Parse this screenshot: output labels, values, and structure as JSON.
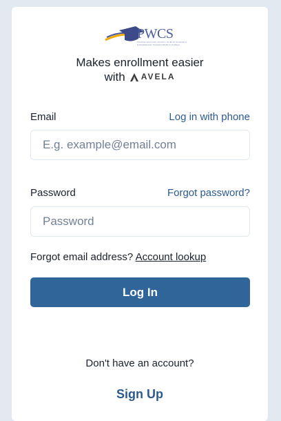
{
  "brand": {
    "logo_text": "PWCS",
    "logo_subline1": "PRINCE WILLIAM COUNTY PUBLIC SCHOOLS",
    "logo_subline2": "EXPERIENCE TRANSFORMS FUTURES",
    "tagline_line1": "Makes enrollment easier",
    "tagline_with": "with",
    "partner_name": "AVELA"
  },
  "form": {
    "email_label": "Email",
    "phone_link": "Log in with phone",
    "email_placeholder": "E.g. example@email.com",
    "email_value": "",
    "password_label": "Password",
    "forgot_password_link": "Forgot password?",
    "password_placeholder": "Password",
    "password_value": "",
    "forgot_email_text": "Forgot email address?",
    "account_lookup_link": "Account lookup",
    "login_button": "Log In"
  },
  "footer": {
    "no_account_text": "Don't have an account?",
    "signup_link": "Sign Up"
  },
  "colors": {
    "page_bg": "#e2e8f0",
    "primary": "#2f6598",
    "link": "#2b5a8f"
  }
}
